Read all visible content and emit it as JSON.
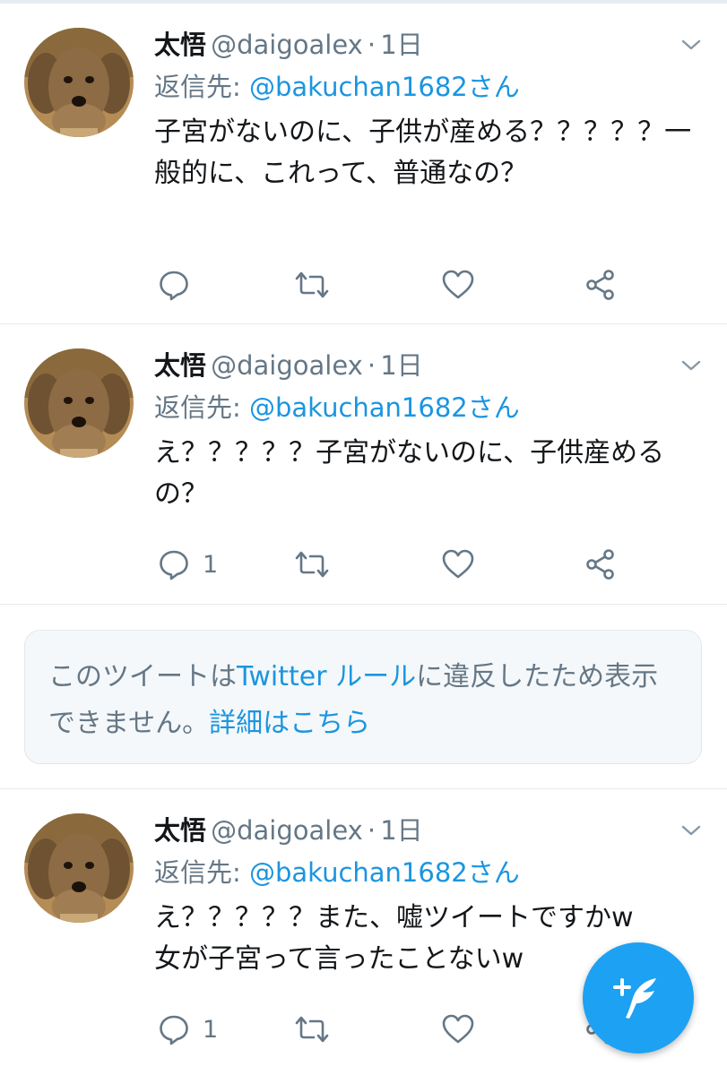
{
  "colors": {
    "accent": "#1da1f2",
    "link": "#1b95e0",
    "text": "#14171a",
    "muted": "#657786",
    "divider": "#e6ecf0"
  },
  "tweets": [
    {
      "name": "太悟",
      "handle": "@daigoalex",
      "separator": "·",
      "time": "1日",
      "reply_prefix": "返信先: ",
      "reply_mention": "@bakuchan1682さん",
      "text": "子宮がないのに、子供が産める？？？？？一般的に、これって、普通なの？",
      "reply_count": "",
      "icons": [
        "reply-icon",
        "retweet-icon",
        "like-icon",
        "share-icon",
        "chevron-down-icon"
      ]
    },
    {
      "name": "太悟",
      "handle": "@daigoalex",
      "separator": "·",
      "time": "1日",
      "reply_prefix": "返信先: ",
      "reply_mention": "@bakuchan1682さん",
      "text": "え？？？？？子宮がないのに、子供産めるの？",
      "reply_count": "1",
      "icons": [
        "reply-icon",
        "retweet-icon",
        "like-icon",
        "share-icon",
        "chevron-down-icon"
      ]
    },
    {
      "name": "太悟",
      "handle": "@daigoalex",
      "separator": "·",
      "time": "1日",
      "reply_prefix": "返信先: ",
      "reply_mention": "@bakuchan1682さん",
      "text_line1": "え？？？？？また、嘘ツイートですかw",
      "text_line2": "女が子宮って言ったことないw",
      "reply_count": "1",
      "icons": [
        "reply-icon",
        "retweet-icon",
        "like-icon",
        "share-icon",
        "chevron-down-icon"
      ]
    }
  ],
  "withheld_notice": {
    "text_part1": "このツイートは",
    "link1": "Twitter ルール",
    "text_part2": "に違反したため表示できません。",
    "link2": "詳細はこちら"
  },
  "compose_button": {
    "icon": "compose-feather-icon"
  }
}
